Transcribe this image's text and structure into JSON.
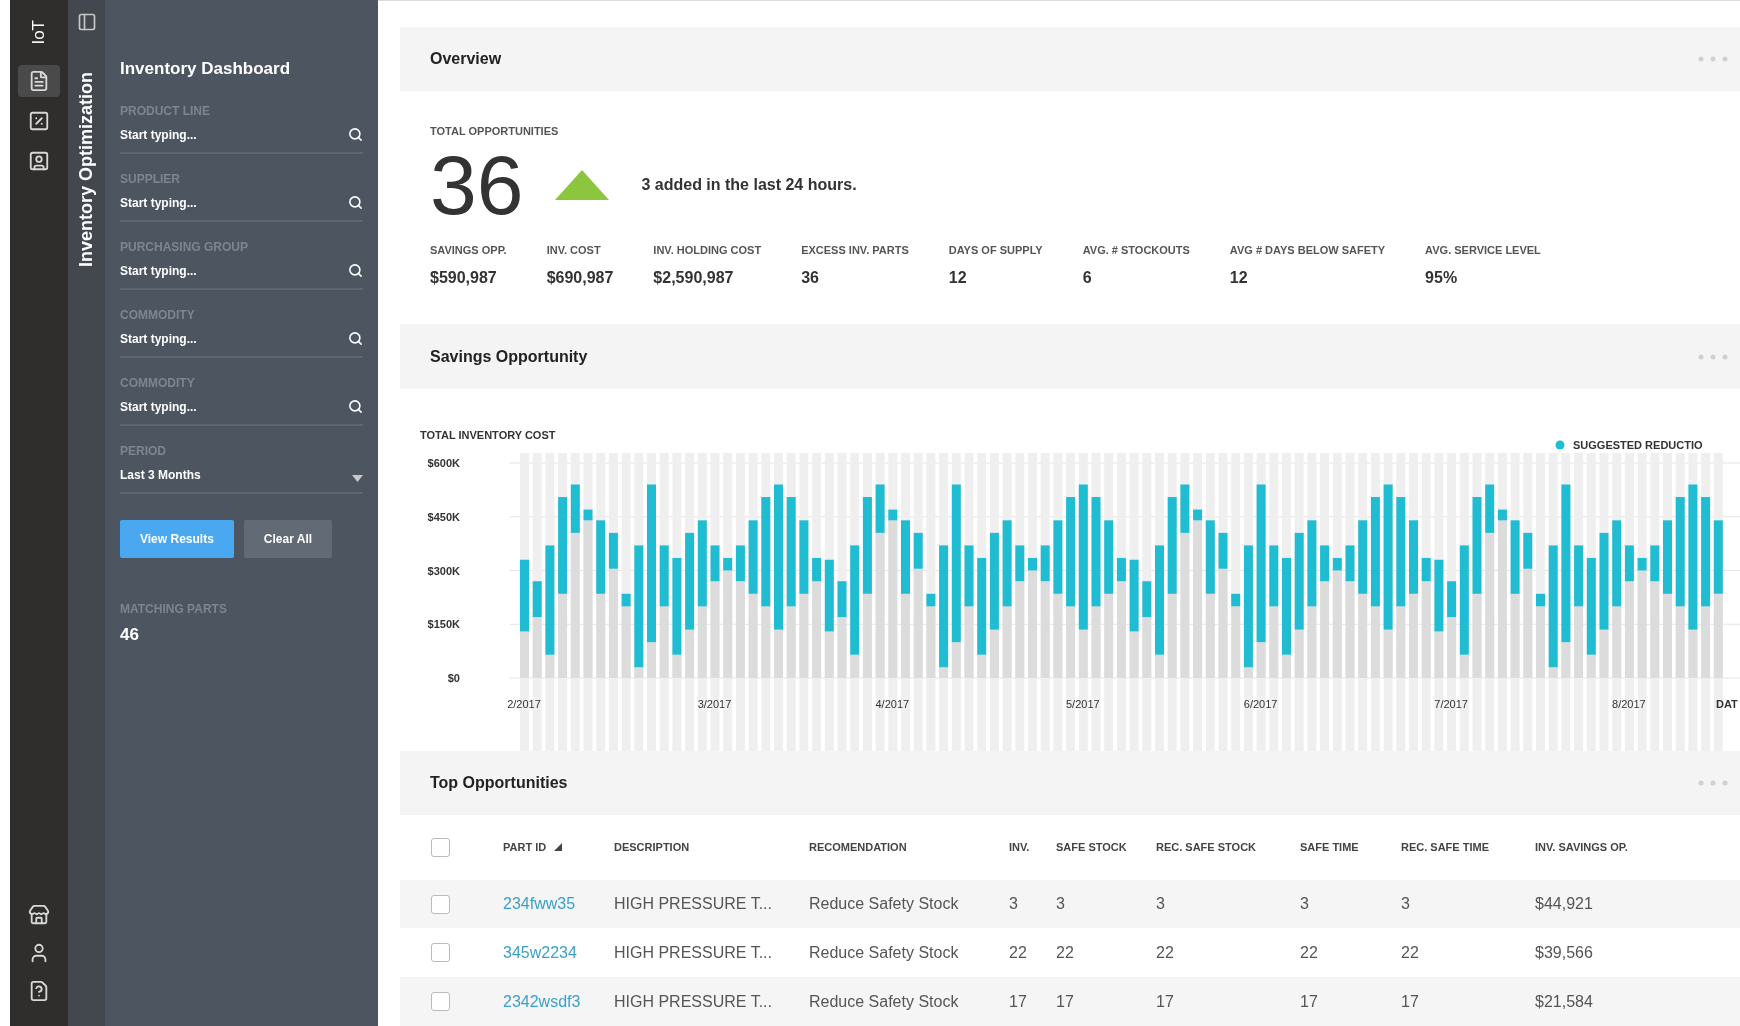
{
  "rail": {
    "logo": "IoT",
    "nav": [
      {
        "kind": "report",
        "selected": true
      },
      {
        "kind": "percent",
        "selected": false
      },
      {
        "kind": "profile",
        "selected": false
      }
    ],
    "bottom": [
      {
        "kind": "store"
      },
      {
        "kind": "user"
      },
      {
        "kind": "help"
      }
    ]
  },
  "app_title": "Inventory Optimization",
  "filters": {
    "title": "Inventory Dashboard",
    "fields": [
      {
        "label": "PRODUCT LINE",
        "kind": "search",
        "placeholder": "Start typing..."
      },
      {
        "label": "SUPPLIER",
        "kind": "search",
        "placeholder": "Start typing..."
      },
      {
        "label": "PURCHASING GROUP",
        "kind": "search",
        "placeholder": "Start typing..."
      },
      {
        "label": "COMMODITY",
        "kind": "search",
        "placeholder": "Start typing..."
      },
      {
        "label": "COMMODITY",
        "kind": "search",
        "placeholder": "Start typing..."
      },
      {
        "label": "PERIOD",
        "kind": "select",
        "value": "Last 3 Months"
      }
    ],
    "buttons": [
      {
        "label": "View Results",
        "kind": "primary"
      },
      {
        "label": "Clear All",
        "kind": "secondary"
      }
    ],
    "matching_label": "MATCHING PARTS",
    "matching_value": "46"
  },
  "overview": {
    "title": "Overview",
    "total_label": "TOTAL OPPORTUNITIES",
    "total": "36",
    "trend": {
      "kind": "up",
      "text": "3 added in the last 24 hours."
    },
    "stats": [
      {
        "label": "SAVINGS OPP.",
        "value": "$590,987"
      },
      {
        "label": "INV. COST",
        "value": "$690,987"
      },
      {
        "label": "INV. HOLDING COST",
        "value": "$2,590,987"
      },
      {
        "label": "EXCESS INV. PARTS",
        "value": "36"
      },
      {
        "label": "DAYS OF SUPPLY",
        "value": "12"
      },
      {
        "label": "AVG. # STOCKOUTS",
        "value": "6"
      },
      {
        "label": "AVG # DAYS BELOW SAFETY",
        "value": "12"
      },
      {
        "label": "AVG. SERVICE LEVEL",
        "value": "95%"
      }
    ]
  },
  "savings": {
    "title": "Savings Opportunity",
    "chart_data": {
      "type": "bar",
      "stacked": true,
      "grid": true,
      "title": "TOTAL INVENTORY COST",
      "xlabel": "DAT",
      "categories": [
        "2/2017",
        null,
        null,
        null,
        null,
        null,
        null,
        null,
        null,
        null,
        null,
        null,
        null,
        null,
        null,
        "3/2017",
        null,
        null,
        null,
        null,
        null,
        null,
        null,
        null,
        null,
        null,
        null,
        null,
        null,
        "4/2017",
        null,
        null,
        null,
        null,
        null,
        null,
        null,
        null,
        null,
        null,
        null,
        null,
        null,
        null,
        "5/2017",
        null,
        null,
        null,
        null,
        null,
        null,
        null,
        null,
        null,
        null,
        null,
        null,
        null,
        "6/2017",
        null,
        null,
        null,
        null,
        null,
        null,
        null,
        null,
        null,
        null,
        null,
        null,
        null,
        null,
        "7/2017",
        null,
        null,
        null,
        null,
        null,
        null,
        null,
        null,
        null,
        null,
        null,
        null,
        null,
        "8/2017",
        null,
        null,
        null,
        null,
        null,
        null,
        null
      ],
      "ylim": [
        0,
        600
      ],
      "yticks": [
        {
          "value": 0,
          "label": "$0"
        },
        {
          "value": 150,
          "label": "$150K"
        },
        {
          "value": 300,
          "label": "$300K"
        },
        {
          "value": 450,
          "label": "$450K"
        },
        {
          "value": 600,
          "label": "$600K"
        }
      ],
      "series": [
        {
          "color": "#dcdcdc",
          "values": [
            130,
            170,
            65,
            235,
            405,
            440,
            235,
            305,
            200,
            30,
            100,
            200,
            65,
            135,
            200,
            270,
            300,
            270,
            235,
            200,
            135,
            200,
            235,
            270,
            130,
            170,
            65,
            235,
            405,
            440,
            235,
            305,
            200,
            30,
            100,
            200,
            65,
            135,
            200,
            270,
            300,
            270,
            235,
            200,
            135,
            200,
            235,
            270,
            130,
            170,
            65,
            235,
            405,
            440,
            235,
            305,
            200,
            30,
            100,
            200,
            65,
            135,
            200,
            270,
            300,
            270,
            235,
            200,
            135,
            200,
            235,
            270,
            130,
            170,
            65,
            235,
            405,
            440,
            235,
            305,
            200,
            30,
            100,
            200,
            65,
            135,
            200,
            270,
            300,
            270,
            235,
            200,
            135,
            200,
            235
          ]
        },
        {
          "name": "SUGGESTED REDUCTIO",
          "color": "#1fbcd2",
          "values": [
            200,
            100,
            305,
            270,
            135,
            30,
            205,
            100,
            35,
            340,
            440,
            170,
            270,
            270,
            240,
            100,
            35,
            100,
            205,
            305,
            405,
            305,
            205,
            65,
            200,
            100,
            305,
            270,
            135,
            30,
            205,
            100,
            35,
            340,
            440,
            170,
            270,
            270,
            240,
            100,
            35,
            100,
            205,
            305,
            405,
            305,
            205,
            65,
            200,
            100,
            305,
            270,
            135,
            30,
            205,
            100,
            35,
            340,
            440,
            170,
            270,
            270,
            240,
            100,
            35,
            100,
            205,
            305,
            405,
            305,
            205,
            65,
            200,
            100,
            305,
            270,
            135,
            30,
            205,
            100,
            35,
            340,
            440,
            170,
            270,
            270,
            240,
            100,
            35,
            100,
            205,
            305,
            405,
            305,
            205
          ]
        }
      ]
    }
  },
  "opportunities": {
    "title": "Top Opportunities",
    "select_all_checked": false,
    "columns": [
      {
        "label": "PART ID",
        "sorted": true
      },
      {
        "label": "DESCRIPTION"
      },
      {
        "label": "RECOMENDATION"
      },
      {
        "label": "INV."
      },
      {
        "label": "SAFE STOCK"
      },
      {
        "label": "REC. SAFE STOCK"
      },
      {
        "label": "SAFE TIME"
      },
      {
        "label": "REC. SAFE TIME"
      },
      {
        "label": "INV. SAVINGS OP."
      }
    ],
    "rows": [
      {
        "checked": false,
        "cells": [
          "234fww35",
          "HIGH PRESSURE T...",
          "Reduce Safety Stock",
          "3",
          "3",
          "3",
          "3",
          "3",
          "$44,921"
        ]
      },
      {
        "checked": false,
        "cells": [
          "345w2234",
          "HIGH PRESSURE T...",
          "Reduce Safety Stock",
          "22",
          "22",
          "22",
          "22",
          "22",
          "$39,566"
        ]
      },
      {
        "checked": false,
        "cells": [
          "2342wsdf3",
          "HIGH PRESSURE T...",
          "Reduce Safety Stock",
          "17",
          "17",
          "17",
          "17",
          "17",
          "$21,584"
        ]
      }
    ]
  }
}
